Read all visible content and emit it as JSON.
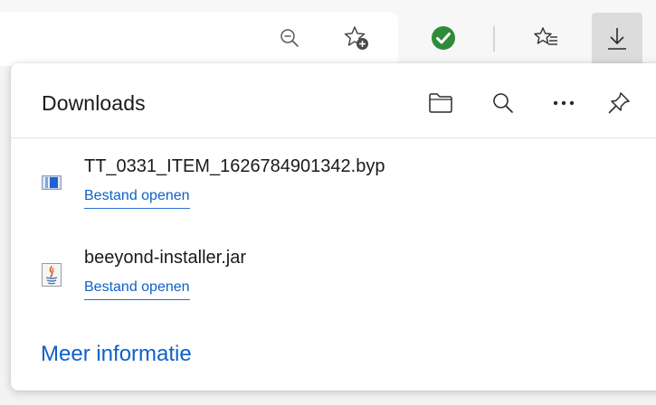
{
  "toolbar": {
    "zoom_icon": "zoom-out-icon",
    "add_favorite_icon": "star-add-icon",
    "extension_icon": "green-check-icon",
    "favorites_icon": "favorites-list-icon",
    "downloads_icon": "download-arrow-icon"
  },
  "panel": {
    "title": "Downloads",
    "actions": [
      "open-folder-icon",
      "search-icon",
      "more-options-icon",
      "pin-icon"
    ]
  },
  "downloads": [
    {
      "file_name": "TT_0331_ITEM_1626784901342.byp",
      "action": "Bestand openen",
      "icon": "byp-file-icon"
    },
    {
      "file_name": "beeyond-installer.jar",
      "action": "Bestand openen",
      "icon": "java-jar-icon"
    }
  ],
  "more_info": "Meer informatie",
  "colors": {
    "link": "#0e60c8",
    "extension_green": "#2e8b3a"
  }
}
